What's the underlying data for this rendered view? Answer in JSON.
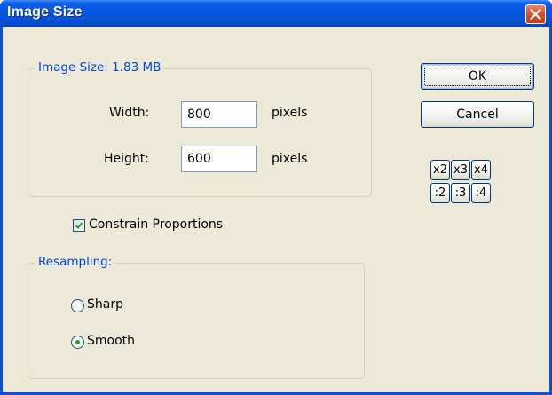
{
  "window": {
    "title": "Image Size",
    "close_icon": "close-x-icon",
    "titlebar_color": "#0a55e0",
    "close_color": "#d9532e"
  },
  "image_size_group": {
    "title": "Image Size: 1.83 MB",
    "width_label": "Width:",
    "width_value": "800",
    "width_unit": "pixels",
    "height_label": "Height:",
    "height_value": "600",
    "height_unit": "pixels"
  },
  "constrain": {
    "label": "Constrain Proportions",
    "checked": true
  },
  "resampling_group": {
    "title": "Resampling:",
    "options": [
      {
        "label": "Sharp",
        "selected": false
      },
      {
        "label": "Smooth",
        "selected": true
      }
    ]
  },
  "buttons": {
    "ok": "OK",
    "cancel": "Cancel"
  },
  "scale_buttons": {
    "multiply": [
      "x2",
      "x3",
      "x4"
    ],
    "divide": [
      ":2",
      ":3",
      ":4"
    ]
  },
  "colors": {
    "group_title": "#0046d5",
    "radio_dot": "#21a121",
    "dialog_bg": "#ece9d8"
  }
}
